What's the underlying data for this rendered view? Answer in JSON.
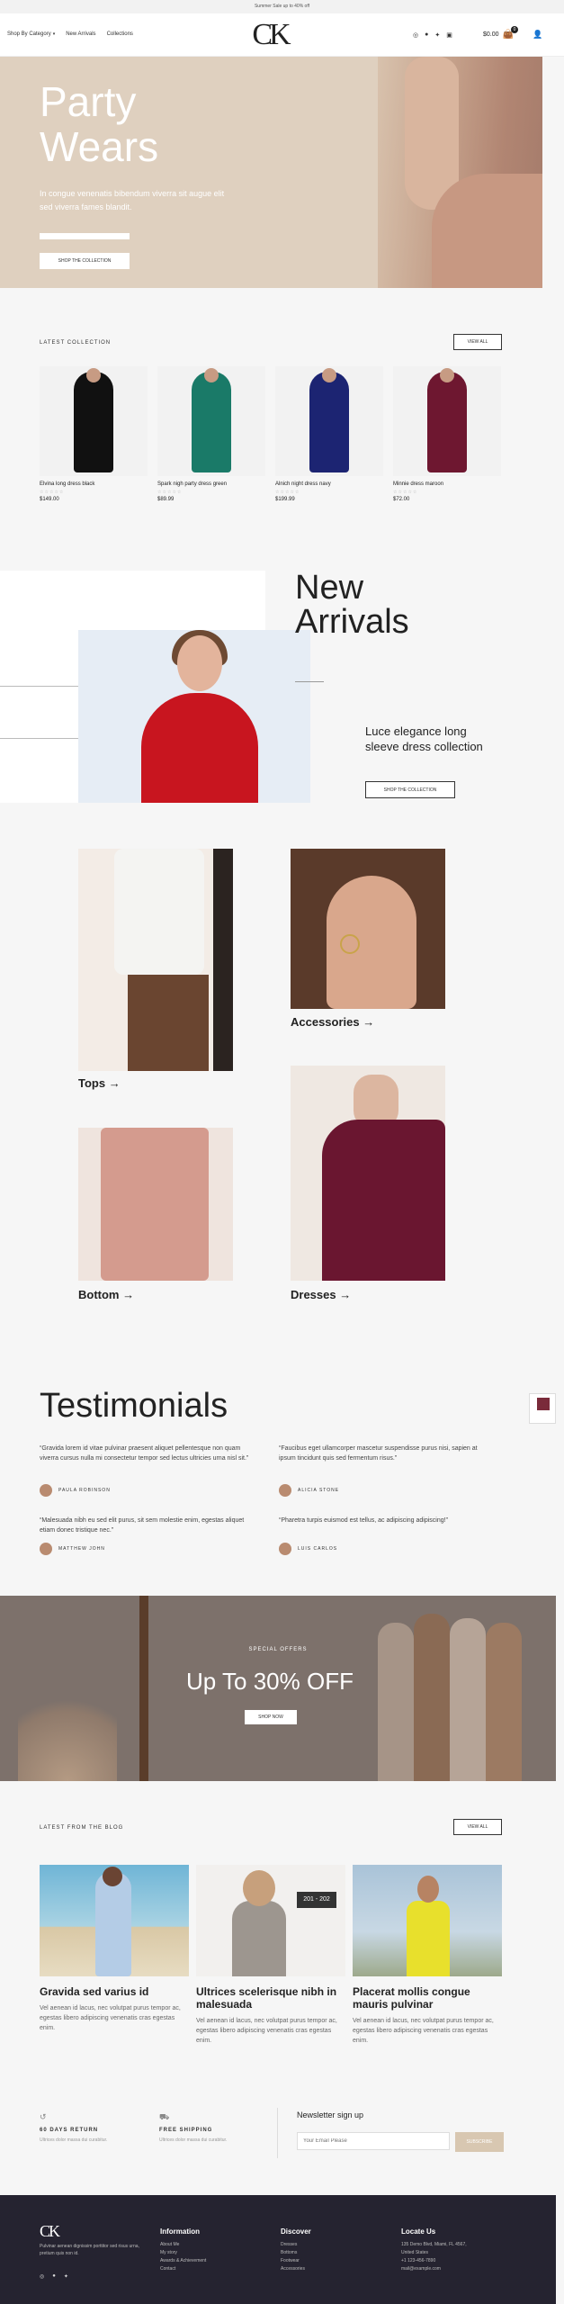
{
  "topbar": {
    "text": "Summer Sale up to 40% off"
  },
  "header": {
    "nav": [
      "Shop By Category",
      "New Arrivals",
      "Collections"
    ],
    "logo": "CK",
    "cart_total": "$0.00",
    "cart_count": "0"
  },
  "hero": {
    "title_line1": "Party",
    "title_line2": "Wears",
    "subtitle": "In congue venenatis bibendum viverra sit augue elit sed viverra fames blandit.",
    "cta": "SHOP THE COLLECTION"
  },
  "latest": {
    "label": "LATEST COLLECTION",
    "view_all": "VIEW ALL",
    "products": [
      {
        "name": "Elvina long dress black",
        "price": "$149.00",
        "color": "#111111"
      },
      {
        "name": "Spark nigh party dress green",
        "price": "$89.99",
        "color": "#1a7a68"
      },
      {
        "name": "Alnich night dress navy",
        "price": "$199.99",
        "color": "#1c2472"
      },
      {
        "name": "Minnie dress maroon",
        "price": "$72.00",
        "color": "#6e1730"
      }
    ],
    "stars": "☆☆☆☆☆"
  },
  "new_arrivals": {
    "title_line1": "New",
    "title_line2": "Arrivals",
    "description": "Luce elegance long sleeve dress collection",
    "cta": "SHOP THE COLLECTION"
  },
  "categories": [
    {
      "label": "Tops →"
    },
    {
      "label": "Accessories →"
    },
    {
      "label": "Bottom →"
    },
    {
      "label": "Dresses →"
    }
  ],
  "testimonials": {
    "title": "Testimonials",
    "items": [
      {
        "quote": "“Gravida lorem id vitae pulvinar praesent aliquet pellentesque non quam viverra cursus nulla mi consectetur tempor sed lectus ultricies urna nisl sit.”",
        "author": "PAULA ROBINSON"
      },
      {
        "quote": "“Faucibus eget ullamcorper mascetur suspendisse purus nisi, sapien at ipsum tincidunt quis sed fermentum risus.”",
        "author": "ALICIA STONE"
      },
      {
        "quote": "“Malesuada nibh eu sed elit purus, sit sem molestie enim, egestas aliquet etiam donec tristique nec.”",
        "author": "MATTHEW JOHN"
      },
      {
        "quote": "“Pharetra turpis euismod est tellus, ac adipiscing adipiscing!”",
        "author": "LUIS CARLOS"
      }
    ]
  },
  "promo": {
    "label": "SPECIAL OFFERS",
    "headline": "Up To 30% OFF",
    "cta": "SHOP NOW"
  },
  "blog": {
    "label": "LATEST FROM THE BLOG",
    "view_all": "VIEW ALL",
    "posts": [
      {
        "title": "Gravida sed varius id",
        "excerpt": "Vel aenean id lacus, nec volutpat purus tempor ac, egestas libero adipiscing venenatis cras egestas enim."
      },
      {
        "title": "Ultrices scelerisque nibh in malesuada",
        "excerpt": "Vel aenean id lacus, nec volutpat purus tempor ac, egestas libero adipiscing venenatis cras egestas enim."
      },
      {
        "title": "Placerat mollis congue mauris pulvinar",
        "excerpt": "Vel aenean id lacus, nec volutpat purus tempor ac, egestas libero adipiscing venenatis cras egestas enim."
      }
    ],
    "sign_text": "201 - 202"
  },
  "features": {
    "items": [
      {
        "title": "60 DAYS RETURN",
        "sub": "Ultrices dolor massa dui curabitur."
      },
      {
        "title": "FREE SHIPPING",
        "sub": "Ultrices dolor massa dui curabitur."
      }
    ],
    "newsletter_title": "Newsletter sign up",
    "newsletter_placeholder": "Your Email Please",
    "newsletter_button": "SUBSCRIBE"
  },
  "footer": {
    "logo": "CK",
    "description": "Pulvinar aenean dignissim porttitor sed risus urna, pretium quis non id.",
    "columns": [
      {
        "title": "Information",
        "links": [
          "About Me",
          "My story",
          "Awards & Achievement",
          "Contact"
        ]
      },
      {
        "title": "Discover",
        "links": [
          "Dresses",
          "Bottoms",
          "Footwear",
          "Accessories"
        ]
      },
      {
        "title": "Locate Us",
        "links": [
          "135 Demo Blvd, Miami, FL 4567,",
          "United States",
          "+1 123-456-7890",
          "mail@example.com"
        ]
      }
    ]
  },
  "colors": {
    "hero_bg": "#dfd0bf",
    "footer_bg": "#252330",
    "accent": "#d8c7b1"
  }
}
